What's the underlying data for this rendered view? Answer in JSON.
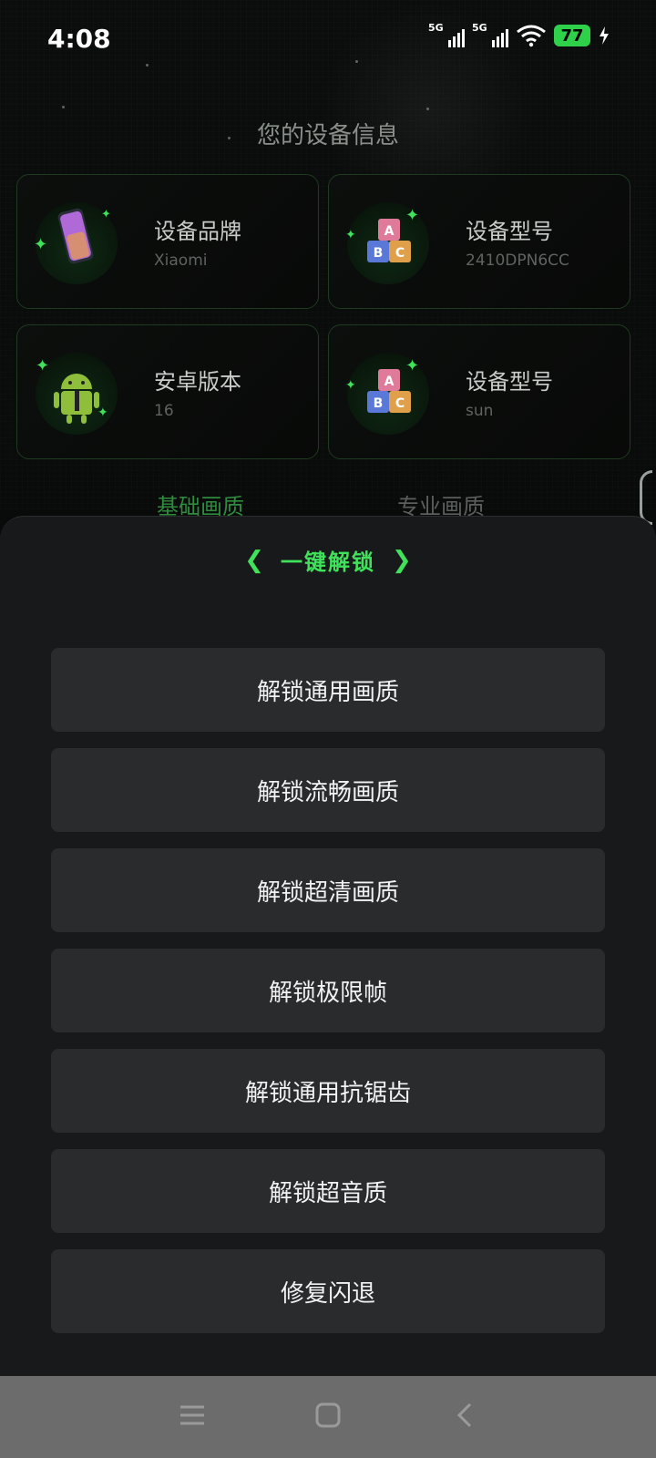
{
  "status": {
    "time": "4:08",
    "signal1": "5G",
    "signal2": "5G",
    "battery": "77"
  },
  "device_info": {
    "title": "您的设备信息",
    "cards": [
      {
        "title": "设备品牌",
        "value": "Xiaomi",
        "icon": "phone-icon"
      },
      {
        "title": "设备型号",
        "value": "2410DPN6CC",
        "icon": "abc-blocks-icon"
      },
      {
        "title": "安卓版本",
        "value": "16",
        "icon": "android-icon"
      },
      {
        "title": "设备型号",
        "value": "sun",
        "icon": "abc-blocks-icon"
      }
    ]
  },
  "tabs": [
    {
      "label": "基础画质",
      "active": true
    },
    {
      "label": "专业画质",
      "active": false
    }
  ],
  "sheet": {
    "title": "一键解锁",
    "buttons": [
      "解锁通用画质",
      "解锁流畅画质",
      "解锁超清画质",
      "解锁极限帧",
      "解锁通用抗锯齿",
      "解锁超音质",
      "修复闪退"
    ]
  },
  "colors": {
    "accent": "#3fe25a",
    "sheet_bg": "#18191a",
    "button_bg": "#2a2b2d"
  },
  "nav": {
    "icons": [
      "menu-icon",
      "home-icon",
      "back-icon"
    ]
  }
}
